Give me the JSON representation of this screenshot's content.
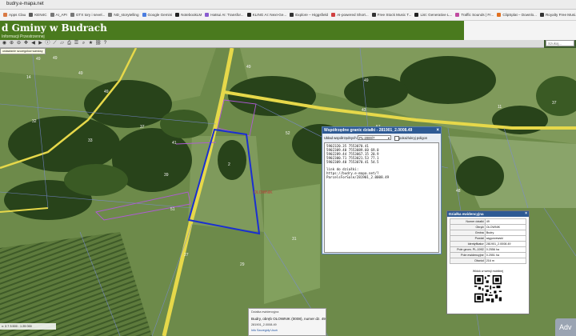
{
  "browser": {
    "url": "budry.e-mapa.net",
    "bookmarks": [
      {
        "label": "Apps Clau",
        "color": "#d97a45"
      },
      {
        "label": "KEN4C",
        "color": "#5a5a5a"
      },
      {
        "label": "AI_API",
        "color": "#777777"
      },
      {
        "label": "GTX tory i sevel...",
        "color": "#777777"
      },
      {
        "label": "ND_storytelling",
        "color": "#777777"
      },
      {
        "label": "Google Gemini",
        "color": "#4a7de0"
      },
      {
        "label": "NotebookLM",
        "color": "#222222"
      },
      {
        "label": "Hatsui AI: Transfor...",
        "color": "#8a5cd0"
      },
      {
        "label": "KLING AI: Next-Ge...",
        "color": "#222222"
      },
      {
        "label": "Explore – Higgsfield",
        "color": "#333333"
      },
      {
        "label": "AI-powered Short...",
        "color": "#d04040"
      },
      {
        "label": "Free Stock Music T...",
        "color": "#333333"
      },
      {
        "label": "List: Generative L...",
        "color": "#222222"
      },
      {
        "label": "Traffic Sounds | Fr...",
        "color": "#c04aa0"
      },
      {
        "label": "ClipSplat – Downlo...",
        "color": "#e07020"
      },
      {
        "label": "Royalty Free Musi...",
        "color": "#333333"
      }
    ]
  },
  "header": {
    "title": "d Gminy w Budrach",
    "subtitle": "Informacji Przestrzennej",
    "search_placeholder": "Szukaj..."
  },
  "toolbar": {
    "layer_tip": "ustawianie szczegółów warstwy"
  },
  "map": {
    "parcel_labels": [
      "49",
      "49",
      "49",
      "14",
      "49",
      "49",
      "32",
      "33",
      "37",
      "41",
      "39",
      "51",
      "49",
      "43",
      "52",
      "11",
      "2",
      "57",
      "48",
      "27",
      "29",
      "31",
      "37"
    ],
    "place_label": "OLOWNIK"
  },
  "coord_panel": {
    "title": "Współrzędne granic działki - 281901_2.0008.49",
    "system_label": "Układ współrzędnych:",
    "system_value": "PL-2000/7",
    "show_polygon_label": "pokaż/ukryj poligon",
    "lines": [
      "5902320.35 7553070.41",
      "5902309.40 7553089.60 69.0",
      "5902289.44 7553067.15 20.9",
      "5902300.71 7553021.53 77.1",
      "5902309.40 7553070.41 54.5"
    ],
    "link_label": "link do działki:",
    "link_url": "https://budry.e-mapa.net/?ParcelsForSale/281901_2.0008.49"
  },
  "detail_panel": {
    "title": "Działka ewidencyjna",
    "rows": [
      {
        "key": "Numer działki",
        "value": "49"
      },
      {
        "key": "Obręb",
        "value": "OLOWNIK"
      },
      {
        "key": "Gmina",
        "value": "Budry"
      },
      {
        "key": "Powiat",
        "value": "węgorzewski"
      },
      {
        "key": "Identyfikator",
        "value": "281901_2.0008.49"
      },
      {
        "key": "Pole geom. PL-1992",
        "value": "0.2556 ha"
      },
      {
        "key": "Pole ewidencyjne",
        "value": "0.2551 ha"
      },
      {
        "key": "Obwód",
        "value": "216 m"
      }
    ],
    "mobile_label": "Widok w wersji mobilnej"
  },
  "bottom_popup": {
    "title": "Działka ewidencyjna",
    "main": "Budry, obręb OLOWNIK (0008), numer dz. 49",
    "sub": "281901_2.0008.49",
    "links": "Info  Szczegóły  Usuń"
  },
  "scale": {
    "text": "x: 3 7 3.500 : 1 25 000"
  },
  "corner_badge": {
    "text": "Adv"
  },
  "colors": {
    "header_green": "#4a7a1e",
    "road_yellow": "#e6d84a",
    "parcel_blue": "#1a2fd0",
    "parcel_purple": "#b05ad8",
    "panel_blue": "#2e5a94"
  }
}
